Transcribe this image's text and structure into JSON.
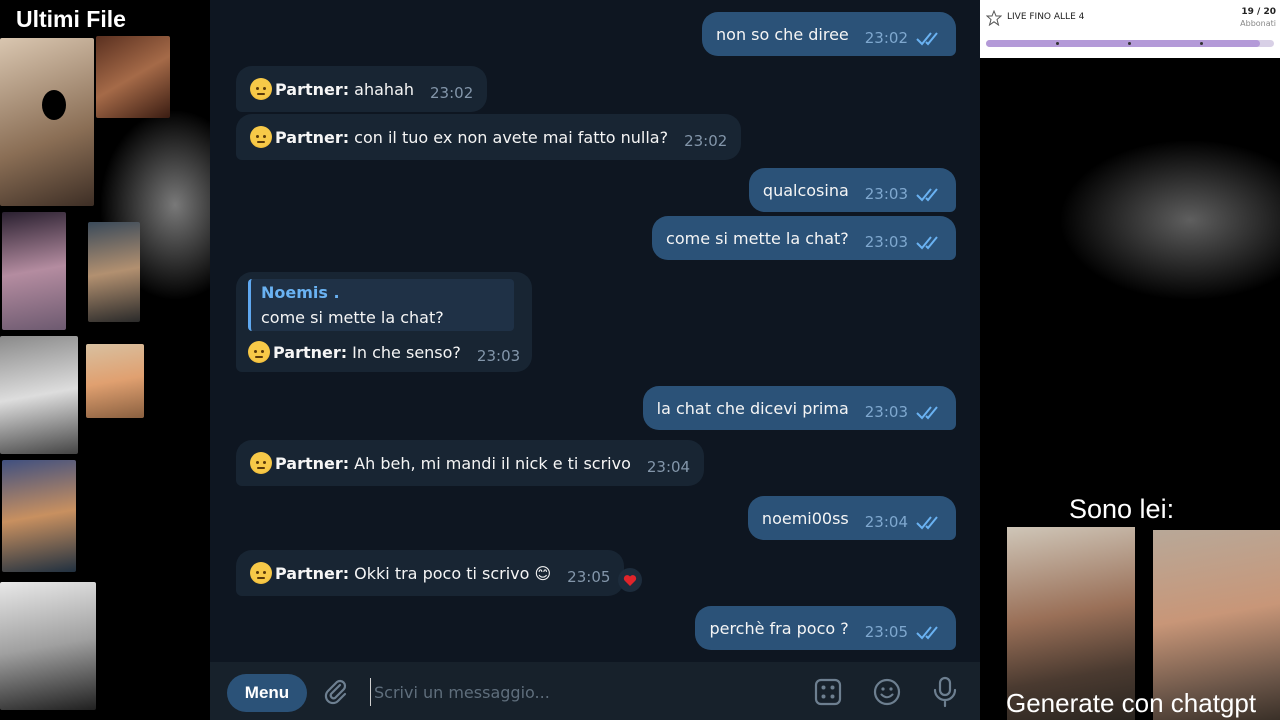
{
  "overlay_left": {
    "title": "Ultimi File"
  },
  "chat": {
    "messages": [
      {
        "direction": "out",
        "text": "non so che diree",
        "time": "23:02",
        "read": true
      },
      {
        "direction": "in",
        "sender": "Partner:",
        "text": "ahahah",
        "time": "23:02"
      },
      {
        "direction": "in",
        "sender": "Partner:",
        "text": "con il tuo ex non avete mai fatto nulla?",
        "time": "23:02"
      },
      {
        "direction": "out",
        "text": "qualcosina",
        "time": "23:03",
        "read": true
      },
      {
        "direction": "out",
        "text": "come si mette la chat?",
        "time": "23:03",
        "read": true
      },
      {
        "direction": "in",
        "sender": "Partner:",
        "text": "In che senso?",
        "time": "23:03",
        "reply_to": {
          "name": "Noemis .",
          "text": "come si mette la chat?"
        }
      },
      {
        "direction": "out",
        "text": "la chat che dicevi prima",
        "time": "23:03",
        "read": true
      },
      {
        "direction": "in",
        "sender": "Partner:",
        "text": "Ah beh, mi mandi il nick e ti scrivo",
        "time": "23:04"
      },
      {
        "direction": "out",
        "text": "noemi00ss",
        "time": "23:04",
        "read": true
      },
      {
        "direction": "in",
        "sender": "Partner:",
        "text": "Okki tra poco ti scrivo 😊",
        "time": "23:05",
        "reaction": "heart-icon"
      },
      {
        "direction": "out",
        "text": "perchè fra poco ?",
        "time": "23:05",
        "read": true
      }
    ],
    "composer": {
      "menu_label": "Menu",
      "placeholder": "Scrivi un messaggio..."
    }
  },
  "overlay_right": {
    "live_label": "LIVE FINO ALLE 4",
    "live_count": "19 / 20",
    "live_sub": "Abbonati",
    "progress": 0.95,
    "caption": "Sono lei:",
    "footer": "Generate con chatgpt"
  },
  "colors": {
    "chat_bg": "#0e1621",
    "bubble_in": "#182533",
    "bubble_out": "#2b5278",
    "accent": "#6ab2f2",
    "reaction_heart": "#e0242a"
  }
}
